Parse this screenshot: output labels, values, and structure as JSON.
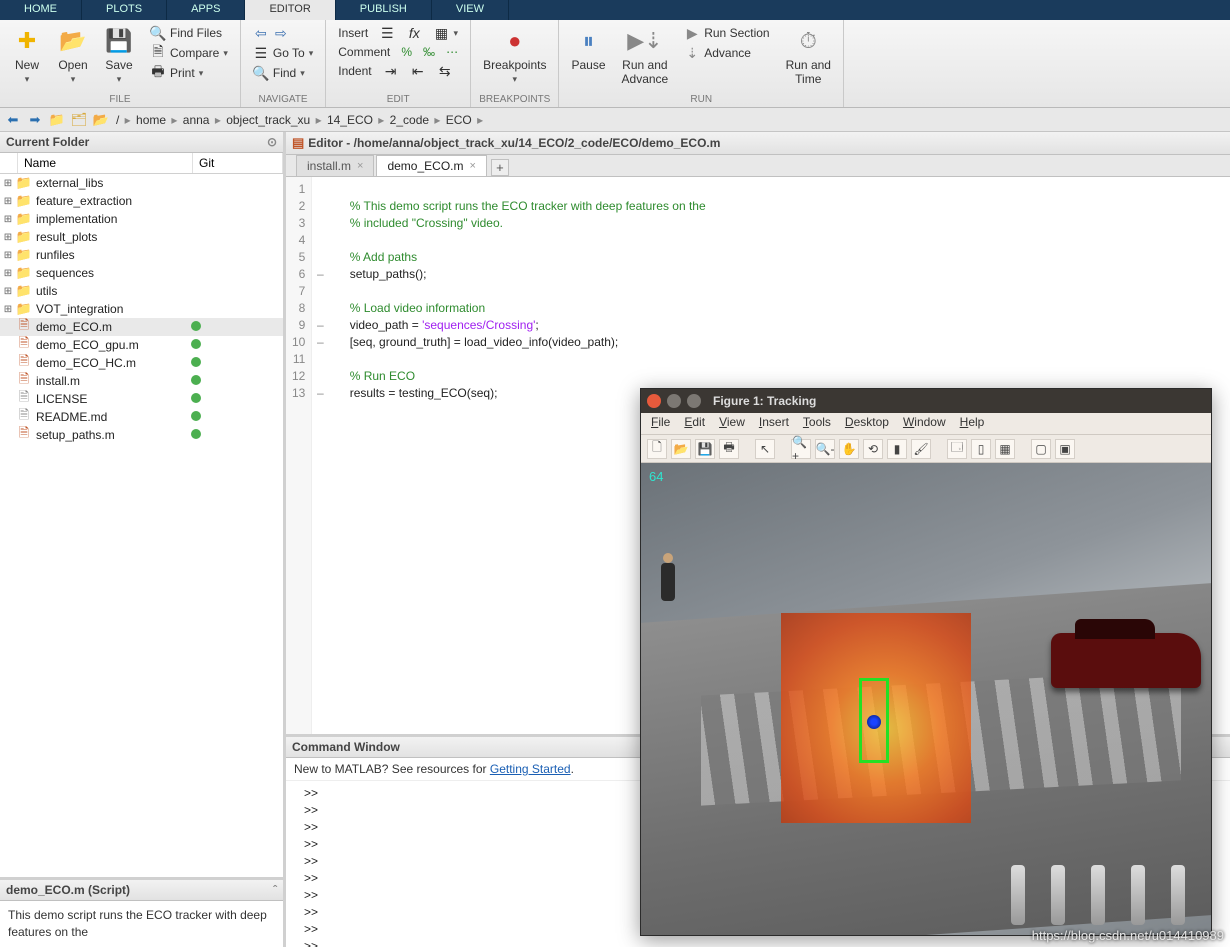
{
  "toptabs": [
    "HOME",
    "PLOTS",
    "APPS",
    "EDITOR",
    "PUBLISH",
    "VIEW"
  ],
  "active_toptab": 3,
  "ribbon": {
    "file": {
      "label": "FILE",
      "new": "New",
      "open": "Open",
      "save": "Save",
      "findfiles": "Find Files",
      "compare": "Compare",
      "print": "Print"
    },
    "navigate": {
      "label": "NAVIGATE",
      "goto": "Go To",
      "find": "Find"
    },
    "edit": {
      "label": "EDIT",
      "insert": "Insert",
      "comment": "Comment",
      "indent": "Indent"
    },
    "breakpoints": {
      "label": "BREAKPOINTS",
      "breakpoints": "Breakpoints"
    },
    "run": {
      "label": "RUN",
      "pause": "Pause",
      "runadv": "Run and\nAdvance",
      "runsection": "Run Section",
      "advance": "Advance",
      "runtime": "Run and\nTime"
    }
  },
  "breadcrumb": [
    "/",
    "home",
    "anna",
    "object_track_xu",
    "14_ECO",
    "2_code",
    "ECO"
  ],
  "current_folder": {
    "title": "Current Folder",
    "cols": {
      "name": "Name",
      "git": "Git"
    },
    "items": [
      {
        "tw": "⊞",
        "icon": "folder",
        "name": "external_libs",
        "git": "",
        "cls": "folderlt"
      },
      {
        "tw": "⊞",
        "icon": "folder",
        "name": "feature_extraction",
        "git": "",
        "cls": "folder"
      },
      {
        "tw": "⊞",
        "icon": "folder",
        "name": "implementation",
        "git": "",
        "cls": "folder"
      },
      {
        "tw": "⊞",
        "icon": "folder",
        "name": "result_plots",
        "git": "",
        "cls": "folderlt"
      },
      {
        "tw": "⊞",
        "icon": "folder",
        "name": "runfiles",
        "git": "",
        "cls": "folder"
      },
      {
        "tw": "⊞",
        "icon": "folder",
        "name": "sequences",
        "git": "",
        "cls": "folderlt"
      },
      {
        "tw": "⊞",
        "icon": "folder",
        "name": "utils",
        "git": "",
        "cls": "folder"
      },
      {
        "tw": "⊞",
        "icon": "folder",
        "name": "VOT_integration",
        "git": "",
        "cls": "folderlt"
      },
      {
        "tw": "",
        "icon": "mfile",
        "name": "demo_ECO.m",
        "git": "●",
        "cls": "mfile",
        "sel": true
      },
      {
        "tw": "",
        "icon": "mfile",
        "name": "demo_ECO_gpu.m",
        "git": "●",
        "cls": "mfile"
      },
      {
        "tw": "",
        "icon": "mfile",
        "name": "demo_ECO_HC.m",
        "git": "●",
        "cls": "mfile"
      },
      {
        "tw": "",
        "icon": "mfile",
        "name": "install.m",
        "git": "●",
        "cls": "mfile"
      },
      {
        "tw": "",
        "icon": "text",
        "name": "LICENSE",
        "git": "●",
        "cls": "txtfile"
      },
      {
        "tw": "",
        "icon": "text",
        "name": "README.md",
        "git": "●",
        "cls": "txtfile"
      },
      {
        "tw": "",
        "icon": "mfile",
        "name": "setup_paths.m",
        "git": "●",
        "cls": "mfile"
      }
    ]
  },
  "script_info": {
    "title": "demo_ECO.m  (Script)",
    "body": "This demo script runs the ECO tracker with deep features on the"
  },
  "editor": {
    "title": "Editor - /home/anna/object_track_xu/14_ECO/2_code/ECO/demo_ECO.m",
    "tabs": [
      {
        "name": "install.m",
        "active": false
      },
      {
        "name": "demo_ECO.m",
        "active": true
      }
    ],
    "lines": [
      {
        "n": 1,
        "f": "",
        "t": ""
      },
      {
        "n": 2,
        "f": "",
        "t": "    % This demo script runs the ECO tracker with deep features on the",
        "cls": "cmt"
      },
      {
        "n": 3,
        "f": "",
        "t": "    % included \"Crossing\" video.",
        "cls": "cmt"
      },
      {
        "n": 4,
        "f": "",
        "t": ""
      },
      {
        "n": 5,
        "f": "",
        "t": "    % Add paths",
        "cls": "cmt"
      },
      {
        "n": 6,
        "f": "–",
        "t": "    setup_paths();"
      },
      {
        "n": 7,
        "f": "",
        "t": ""
      },
      {
        "n": 8,
        "f": "",
        "t": "    % Load video information",
        "cls": "cmt"
      },
      {
        "n": 9,
        "f": "–",
        "html": "    video_path = <span class='str'>'sequences/Crossing'</span>;"
      },
      {
        "n": 10,
        "f": "–",
        "t": "    [seq, ground_truth] = load_video_info(video_path);"
      },
      {
        "n": 11,
        "f": "",
        "t": ""
      },
      {
        "n": 12,
        "f": "",
        "t": "    % Run ECO",
        "cls": "cmt"
      },
      {
        "n": 13,
        "f": "–",
        "t": "    results = testing_ECO(seq);"
      }
    ]
  },
  "command_window": {
    "title": "Command Window",
    "note_prefix": "New to MATLAB? See resources for ",
    "note_link": "Getting Started",
    "note_suffix": ".",
    "prompts": [
      ">>",
      ">>",
      ">>",
      ">>",
      ">>",
      ">>",
      ">>",
      ">>",
      ">>",
      ">>"
    ]
  },
  "figure": {
    "title": "Figure 1: Tracking",
    "menus": [
      "File",
      "Edit",
      "View",
      "Insert",
      "Tools",
      "Desktop",
      "Window",
      "Help"
    ],
    "frame": "64",
    "watermark": "https://blog.csdn.net/u014410989"
  }
}
